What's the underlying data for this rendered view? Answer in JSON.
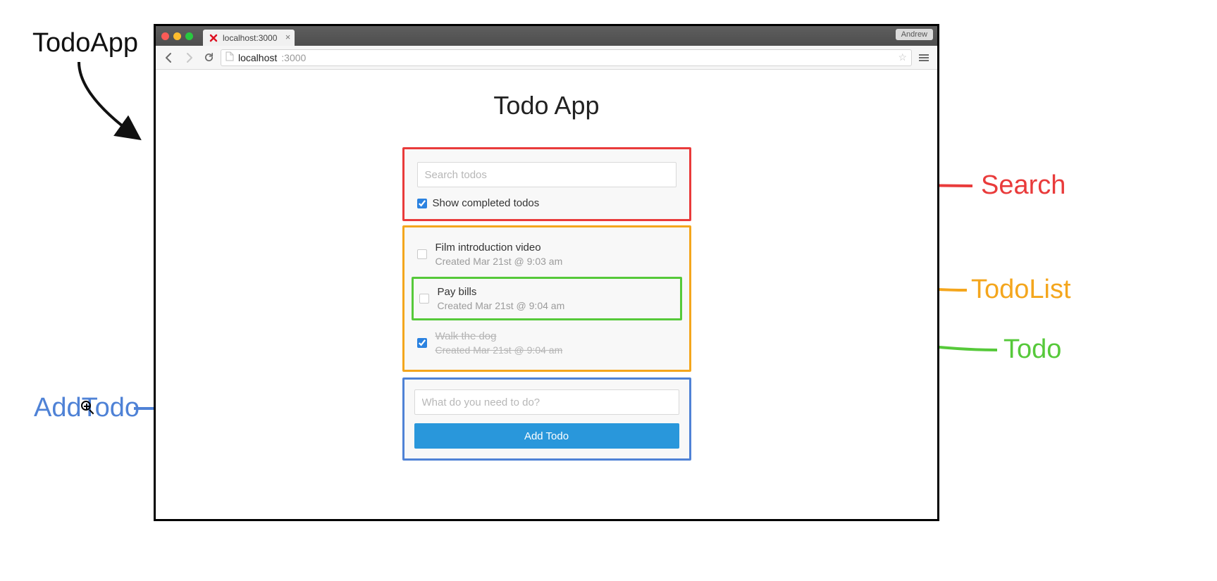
{
  "annotations": {
    "todoapp": {
      "label": "TodoApp"
    },
    "search": {
      "label": "Search"
    },
    "todolist": {
      "label": "TodoList"
    },
    "todo": {
      "label": "Todo"
    },
    "addtodo": {
      "label": "AddTodo"
    }
  },
  "browser": {
    "user": "Andrew",
    "tab_title": "localhost:3000",
    "url_host": "localhost",
    "url_port": ":3000"
  },
  "page": {
    "title": "Todo App"
  },
  "search": {
    "placeholder": "Search todos",
    "show_completed_label": "Show completed todos",
    "show_completed_checked": true
  },
  "todos": [
    {
      "title": "Film introduction video",
      "meta": "Created Mar 21st @ 9:03 am",
      "done": false,
      "highlight": false
    },
    {
      "title": "Pay bills",
      "meta": "Created Mar 21st @ 9:04 am",
      "done": false,
      "highlight": true
    },
    {
      "title": "Walk the dog",
      "meta": "Created Mar 21st @ 9:04 am",
      "done": true,
      "highlight": false
    }
  ],
  "add": {
    "placeholder": "What do you need to do?",
    "button": "Add Todo"
  },
  "colors": {
    "search_border": "#e93b3b",
    "list_border": "#f4a61d",
    "todo_border": "#56c93a",
    "add_border": "#4f82d6",
    "primary_btn": "#2997db"
  }
}
